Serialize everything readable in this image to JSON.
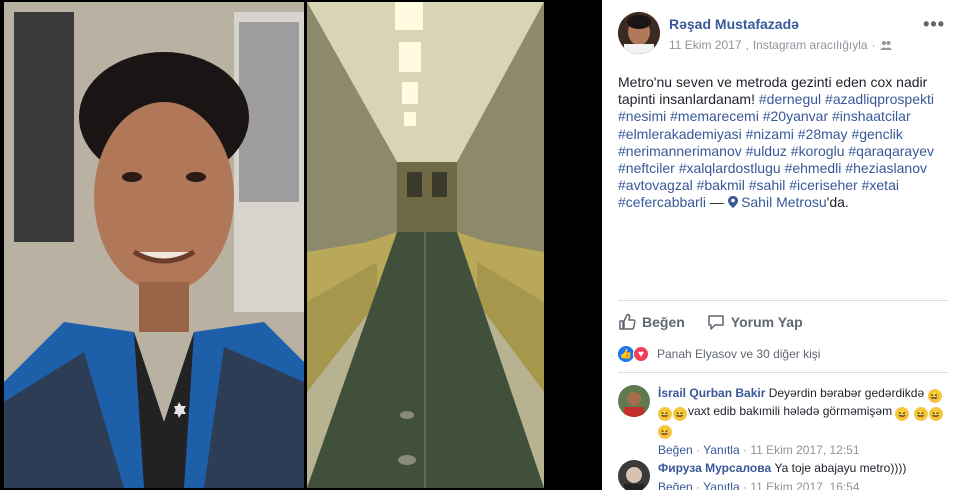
{
  "post": {
    "author": "Rəşad Mustafazadə",
    "date": "11 Ekim 2017",
    "via": "Instagram aracılığıyla",
    "separator": "·",
    "audience_icon": "friends-icon",
    "more_label": "•••",
    "text_lines": [
      {
        "text": "Metro'nu seven ve metroda gezinti eden cox nadir",
        "type": "text"
      },
      {
        "text": "tapinti insanlardanam! ",
        "type": "text"
      }
    ],
    "body_plain": "Metro'nu seven ve metroda gezinti eden cox nadir tapinti insanlardanam!",
    "hashtags": [
      "#dernegul",
      "#azadliqprospekti",
      "#nesimi",
      "#memarecemi",
      "#20yanvar",
      "#inshaatcilar",
      "#elmlerakademiyasi",
      "#nizami",
      "#28may",
      "#genclik",
      "#nerimannerimanov",
      "#ulduz",
      "#koroglu",
      "#qaraqarayev",
      "#neftciler",
      "#xalqlardostlugu",
      "#ehmedli",
      "#heziaslanov",
      "#avtovagzal",
      "#bakmil",
      "#sahil",
      "#iceriseher",
      "#xetai",
      "#cefercabbarli"
    ],
    "place_prefix": "—",
    "place": "Sahil Metrosu",
    "place_suffix": "'da."
  },
  "actions": {
    "like_label": "Beğen",
    "comment_label": "Yorum Yap"
  },
  "reactions": {
    "summary": "Panah Elyasov ve 30 diğer kişi"
  },
  "comments": [
    {
      "name": "İsrail Qurban Bakir",
      "text_before": "Deyərdin bərabər gedərdikdə",
      "text_after": "vaxt edib bakımili hələdə görməmişəm",
      "like": "Beğen",
      "reply": "Yanıtla",
      "sep": "·",
      "time": "11 Ekim 2017, 12:51"
    },
    {
      "name": "Фируза Мурсалова",
      "text_before": "Ya toje abajayu metro))))",
      "like": "Beğen",
      "reply": "Yanıtla",
      "sep": "·",
      "time": "11 Ekim 2017, 16:54"
    }
  ],
  "colors": {
    "link": "#385898",
    "muted": "#90949c",
    "text": "#1d2129"
  }
}
